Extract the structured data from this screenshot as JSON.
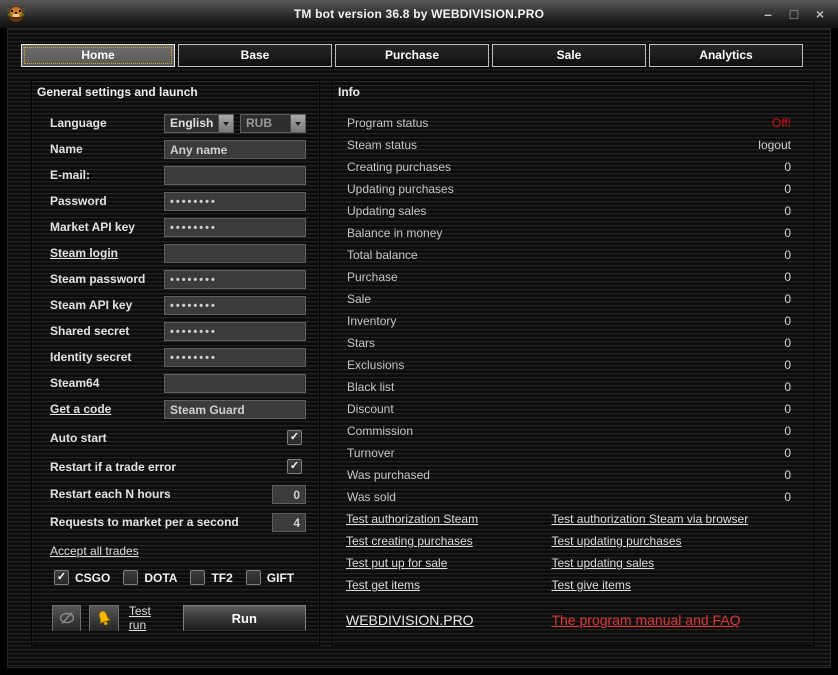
{
  "window": {
    "title": "TM bot version 36.8 by WEBDIVISION.PRO",
    "minimize": "–",
    "maximize": "□",
    "close": "×"
  },
  "tabs": [
    "Home",
    "Base",
    "Purchase",
    "Sale",
    "Analytics"
  ],
  "selected_tab": "Home",
  "colors": {
    "status_off_red": "#d40f0f",
    "manual_link_red": "#e23434",
    "bell_yellow": "#f2b705",
    "tab_focus_dotted": "#e0a030",
    "input_background": "#3b3b3b"
  },
  "general": {
    "title": "General settings and launch",
    "language": {
      "label": "Language",
      "value": "English"
    },
    "currency": {
      "value": "RUB"
    },
    "name": {
      "label": "Name",
      "value": "Any name"
    },
    "email": {
      "label": "E-mail:",
      "value": ""
    },
    "password": {
      "label": "Password",
      "value": "••••••••"
    },
    "market_api_key": {
      "label": "Market API key",
      "value": "••••••••"
    },
    "steam_login": {
      "label": "Steam login",
      "value": ""
    },
    "steam_password": {
      "label": "Steam password",
      "value": "••••••••"
    },
    "steam_api_key": {
      "label": "Steam API key",
      "value": "••••••••"
    },
    "shared_secret": {
      "label": "Shared secret",
      "value": "••••••••"
    },
    "identity_secret": {
      "label": "Identity secret",
      "value": "••••••••"
    },
    "steam64": {
      "label": "Steam64",
      "value": ""
    },
    "get_a_code": {
      "label": "Get a code",
      "value": "Steam Guard"
    },
    "auto_start": {
      "label": "Auto start",
      "mark": "✓"
    },
    "restart_trade_error": {
      "label": "Restart if a trade error",
      "mark": "✓"
    },
    "restart_hours": {
      "label": "Restart each N hours",
      "value": "0"
    },
    "requests_per_second": {
      "label": "Requests to market per a second",
      "value": "4"
    },
    "accept_all_trades": "Accept all trades",
    "games": [
      {
        "label": "CSGO",
        "mark": "✓"
      },
      {
        "label": "DOTA",
        "mark": ""
      },
      {
        "label": "TF2",
        "mark": ""
      },
      {
        "label": "GIFT",
        "mark": ""
      }
    ],
    "test_run": "Test run",
    "run": "Run"
  },
  "info": {
    "title": "Info",
    "rows": [
      {
        "label": "Program status",
        "value": "Off!"
      },
      {
        "label": "Steam status",
        "value": "logout"
      },
      {
        "label": "Creating purchases",
        "value": "0"
      },
      {
        "label": "Updating purchases",
        "value": "0"
      },
      {
        "label": "Updating sales",
        "value": "0"
      },
      {
        "label": "Balance in money",
        "value": "0"
      },
      {
        "label": "Total balance",
        "value": "0"
      },
      {
        "label": "Purchase",
        "value": "0"
      },
      {
        "label": "Sale",
        "value": "0"
      },
      {
        "label": "Inventory",
        "value": "0"
      },
      {
        "label": "Stars",
        "value": "0"
      },
      {
        "label": "Exclusions",
        "value": "0"
      },
      {
        "label": "Black list",
        "value": "0"
      },
      {
        "label": "Discount",
        "value": "0"
      },
      {
        "label": "Commission",
        "value": "0"
      },
      {
        "label": "Turnover",
        "value": "0"
      },
      {
        "label": "Was purchased",
        "value": "0"
      },
      {
        "label": "Was sold",
        "value": "0"
      }
    ],
    "links": [
      [
        "Test authorization Steam",
        "Test authorization Steam via browser"
      ],
      [
        "Test creating purchases",
        "Test updating purchases"
      ],
      [
        "Test put up for sale",
        "Test updating sales"
      ],
      [
        "Test get items",
        "Test give items"
      ]
    ],
    "site_link": "WEBDIVISION.PRO",
    "manual_link": "The program manual and FAQ"
  }
}
